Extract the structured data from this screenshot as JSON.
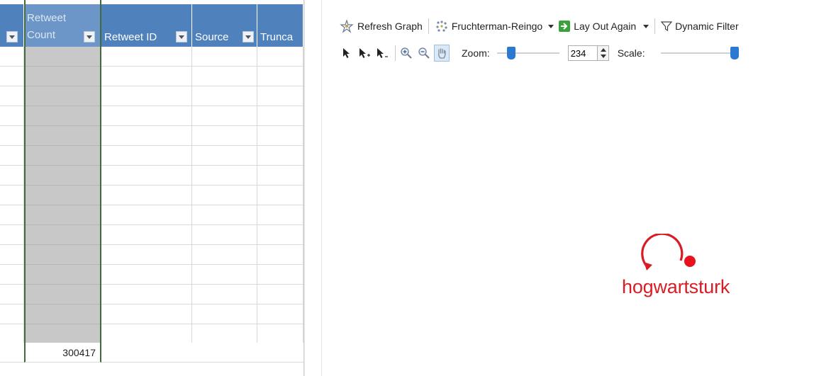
{
  "spreadsheet": {
    "columns": [
      {
        "label": ""
      },
      {
        "label": "Retweet Count",
        "line1": "Retweet",
        "line2": "Count"
      },
      {
        "label": "Retweet ID"
      },
      {
        "label": "Source"
      },
      {
        "label": "Trunca"
      }
    ],
    "total_value": "300417"
  },
  "graph_pane": {
    "toolbar_row1": {
      "refresh_label": "Refresh Graph",
      "layout_label": "Fruchterman-Reingo",
      "lay_out_again_label": "Lay Out Again",
      "dynamic_filter_label": "Dynamic Filter"
    },
    "toolbar_row2": {
      "zoom_label": "Zoom:",
      "zoom_value": "234",
      "scale_label": "Scale:",
      "zoom_slider_level": 0.18,
      "scale_slider_level": 1.0
    },
    "node": {
      "label": "hogwartsturk",
      "color": "#d71e27"
    }
  },
  "colors": {
    "header_blue": "#4f81bd",
    "selected_column_fill": "#c8c8c8",
    "selection_border": "#3f6b3f",
    "slider_thumb": "#2b7ad1"
  }
}
